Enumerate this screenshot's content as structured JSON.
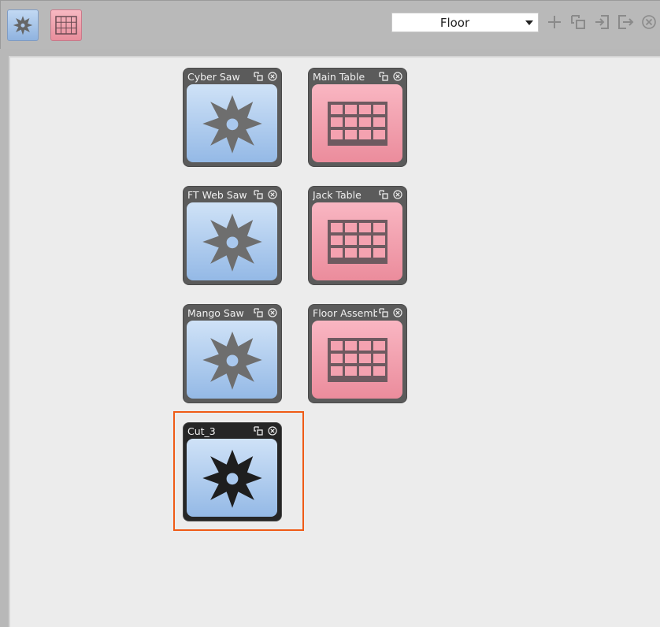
{
  "toolbar": {
    "tool_buttons": [
      {
        "icon": "saw-blade-icon"
      },
      {
        "icon": "table-grid-icon"
      }
    ],
    "layout_select": {
      "value": "Floor"
    },
    "actions": [
      {
        "icon": "plus-icon"
      },
      {
        "icon": "duplicate-icon"
      },
      {
        "icon": "import-icon"
      },
      {
        "icon": "export-icon"
      },
      {
        "icon": "close-circle-icon"
      }
    ]
  },
  "cards": [
    {
      "title": "Cyber Saw",
      "kind": "saw",
      "selected": false
    },
    {
      "title": "Main Table",
      "kind": "table",
      "selected": false
    },
    {
      "title": "FT Web Saw",
      "kind": "saw",
      "selected": false
    },
    {
      "title": "Jack Table",
      "kind": "table",
      "selected": false
    },
    {
      "title": "Mango Saw",
      "kind": "saw",
      "selected": false
    },
    {
      "title": "Floor Assembly",
      "kind": "table",
      "selected": false
    },
    {
      "title": "Cut_3",
      "kind": "saw",
      "selected": true
    }
  ],
  "colors": {
    "toolbar_bg": "#b9b9b9",
    "canvas_bg": "#ececec",
    "saw_body": "#a9c8ee",
    "table_body": "#f09aa8",
    "selection_outline": "#ef5b16"
  }
}
